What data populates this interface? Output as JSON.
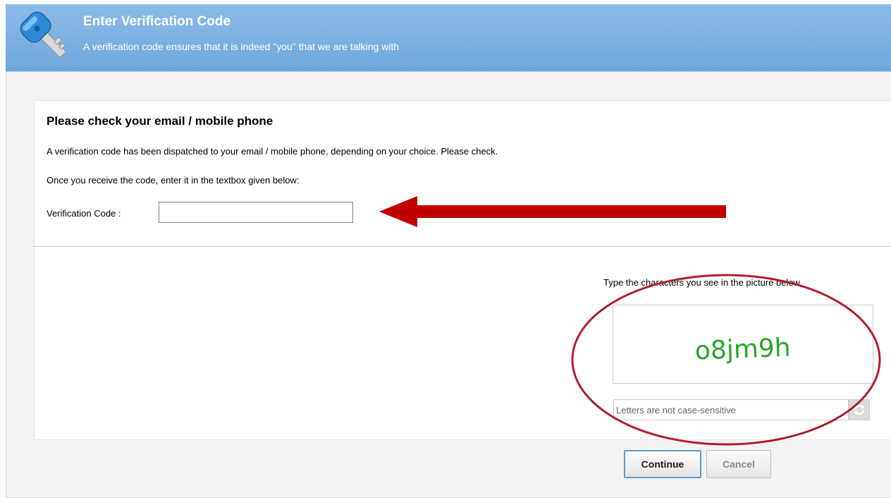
{
  "header": {
    "title": "Enter Verification Code",
    "subtitle": "A verification code ensures that it is indeed \"you\" that we are talking with",
    "icon": "key-icon"
  },
  "main": {
    "section_title": "Please check your email / mobile phone",
    "message1": "A verification code has been dispatched to your email / mobile phone, depending on your choice. Please check.",
    "message2": "Once you receive the code, enter it in the textbox given below:",
    "code_label": "Verification Code :",
    "code_value": ""
  },
  "captcha": {
    "prompt": "Type the characters you see in the picture below.",
    "text": "o8jm9h",
    "placeholder": "Letters are not case-sensitive",
    "refresh_icon": "refresh-icon"
  },
  "buttons": {
    "continue": "Continue",
    "cancel": "Cancel"
  },
  "annotations": {
    "arrow_color": "#c00000",
    "circle_color": "#b01e2a"
  },
  "colors": {
    "header_bg": "#79aee0",
    "captcha_text": "#2aa52a"
  }
}
